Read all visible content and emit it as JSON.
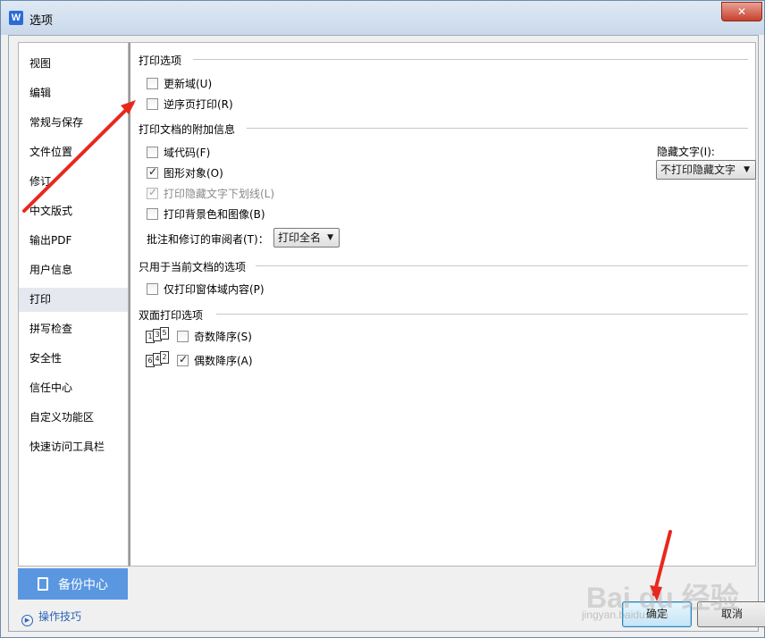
{
  "window": {
    "title": "选项",
    "close_glyph": "✕",
    "app_icon_letter": "W"
  },
  "sidebar": {
    "items": [
      {
        "label": "视图"
      },
      {
        "label": "编辑"
      },
      {
        "label": "常规与保存"
      },
      {
        "label": "文件位置"
      },
      {
        "label": "修订"
      },
      {
        "label": "中文版式"
      },
      {
        "label": "输出PDF"
      },
      {
        "label": "用户信息"
      },
      {
        "label": "打印",
        "active": true
      },
      {
        "label": "拼写检查"
      },
      {
        "label": "安全性"
      },
      {
        "label": "信任中心"
      },
      {
        "label": "自定义功能区"
      },
      {
        "label": "快速访问工具栏"
      }
    ],
    "backup_label": "备份中心",
    "tips_label": "操作技巧"
  },
  "print_options": {
    "title": "打印选项",
    "update_fields": {
      "label": "更新域(U)",
      "checked": false
    },
    "reverse_print": {
      "label": "逆序页打印(R)",
      "checked": false
    }
  },
  "attach_info": {
    "title": "打印文档的附加信息",
    "field_codes": {
      "label": "域代码(F)",
      "checked": false
    },
    "drawing_objects": {
      "label": "图形对象(O)",
      "checked": true
    },
    "hidden_text_underline": {
      "label": "打印隐藏文字下划线(L)",
      "checked": true,
      "disabled": true
    },
    "background": {
      "label": "打印背景色和图像(B)",
      "checked": false
    },
    "reviewer_label": "批注和修订的审阅者(T)：",
    "reviewer_value": "打印全名",
    "hidden_text_label": "隐藏文字(I):",
    "hidden_text_value": "不打印隐藏文字"
  },
  "current_doc": {
    "title": "只用于当前文档的选项",
    "form_only": {
      "label": "仅打印窗体域内容(P)",
      "checked": false
    }
  },
  "duplex": {
    "title": "双面打印选项",
    "odd_label": "奇数降序(S)",
    "odd_checked": false,
    "odd_pages": [
      "1",
      "3",
      "5"
    ],
    "even_label": "偶数降序(A)",
    "even_checked": true,
    "even_pages": [
      "6",
      "4",
      "2"
    ]
  },
  "buttons": {
    "ok": "确定",
    "cancel": "取消"
  },
  "watermark": {
    "brand": "Bai du 经验",
    "url": "jingyan.baidu.com"
  },
  "annotation_color": "#e8281e"
}
